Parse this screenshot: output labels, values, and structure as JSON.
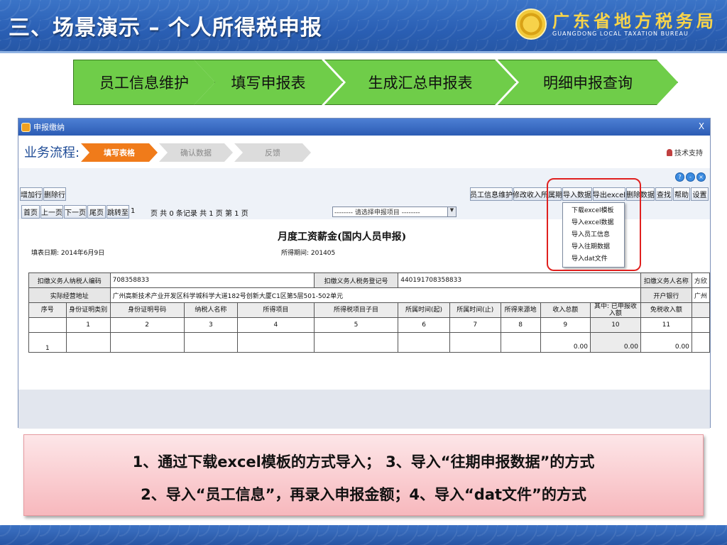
{
  "slide": {
    "title": "三、场景演示 – 个人所得税申报",
    "brand_cn": "广东省地方税务局",
    "brand_en": "GUANGDONG LOCAL TAXATION BUREAU"
  },
  "steps": [
    "员工信息维护",
    "填写申报表",
    "生成汇总申报表",
    "明细申报查询"
  ],
  "window": {
    "title": "申报缴纳",
    "close": "X",
    "flow_label": "业务流程:",
    "flow_steps": [
      "填写表格",
      "确认数据",
      "反馈"
    ],
    "support": "技术支持",
    "circle_icons": [
      "?",
      "-",
      "×"
    ],
    "left_buttons": [
      "增加行",
      "删除行"
    ],
    "right_buttons": [
      "员工信息维护",
      "修改收入所属期",
      "导入数据",
      "导出excel",
      "删除数据",
      "查找",
      "帮助",
      "设置"
    ],
    "pager_buttons": [
      "首页",
      "上一页",
      "下一页",
      "尾页",
      "跳转至"
    ],
    "pager_page_input": "1",
    "pager_info": "页  共  0  条记录   共 1 页    第 1 页",
    "select_value": "-------- 请选择申报项目 --------",
    "import_menu": [
      "下载excel模板",
      "导入excel数据",
      "导入员工信息",
      "导入往期数据",
      "导入dat文件"
    ]
  },
  "report": {
    "title": "月度工资薪金(国内人员申报)",
    "fill_date": "填表日期: 2014年6月9日",
    "period": "所得期间: 201405",
    "info_row1": {
      "label1": "扣缴义务人纳税人编码",
      "value1": "708358833",
      "label2": "扣缴义务人税务登记号",
      "value2": "440191708358833",
      "label3": "扣缴义务人名称",
      "value3": "方欣"
    },
    "info_row2": {
      "label1": "实际经营地址",
      "value1": "广州高新技术产业开发区科学城科学大道182号创新大厦C1区第5层501-502单元",
      "label3": "开户银行",
      "value3": "广州"
    },
    "headers": [
      "序号",
      "身份证明类别",
      "身份证明号码",
      "纳税人名称",
      "所得项目",
      "所得税项目子目",
      "所属时间(起)",
      "所属时间(止)",
      "所得来源地",
      "收入总额",
      "其中: 已申报收入额",
      "免税收入额"
    ],
    "col_numbers": [
      "",
      "1",
      "2",
      "3",
      "4",
      "5",
      "6",
      "7",
      "8",
      "9",
      "10",
      "11"
    ],
    "row1": [
      "1",
      "",
      "",
      "",
      "",
      "",
      "",
      "",
      "",
      "0.00",
      "0.00",
      "0.00"
    ]
  },
  "callout": {
    "line1": "1、通过下载excel模板的方式导入； 3、导入“往期申报数据”的方式",
    "line2": "2、导入“员工信息”，再录入申报金额；4、导入“dat文件”的方式"
  }
}
